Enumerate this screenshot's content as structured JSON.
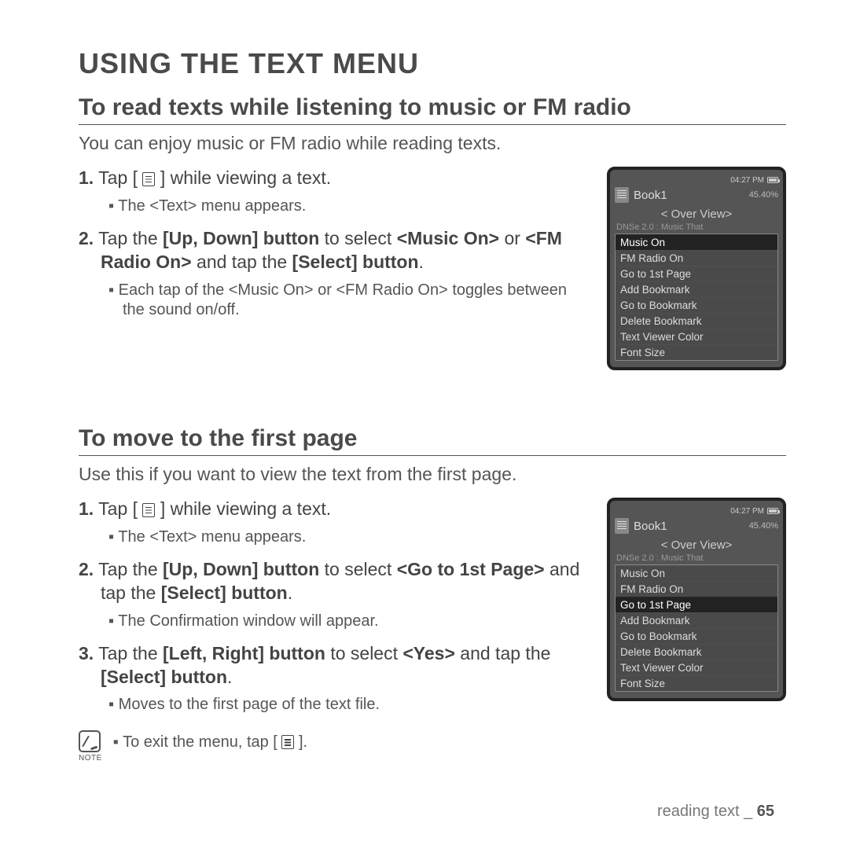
{
  "page_title": "USING THE TEXT MENU",
  "section1": {
    "heading": "To read texts while listening to music or FM radio",
    "intro": "You can enjoy music or FM radio while reading texts.",
    "step1_pre": "Tap [",
    "step1_post": "] while viewing a text.",
    "step1_bullet": "The <Text> menu appears.",
    "step2_a": "Tap the ",
    "step2_b1": "[Up, Down] button",
    "step2_c": " to select ",
    "step2_b2": "<Music On>",
    "step2_d": " or ",
    "step2_b3": "<FM Radio On>",
    "step2_e": " and tap the ",
    "step2_b4": "[Select] button",
    "step2_f": ".",
    "step2_bullet": "Each tap of the <Music On> or <FM Radio On> toggles between the sound on/off."
  },
  "section2": {
    "heading": "To move to the first page",
    "intro": "Use this if you want to view the text from the first page.",
    "step1_pre": "Tap [",
    "step1_post": "] while viewing a text.",
    "step1_bullet": "The <Text> menu appears.",
    "step2_a": "Tap the ",
    "step2_b1": "[Up, Down] button",
    "step2_c": " to select ",
    "step2_b2": "<Go to 1st Page>",
    "step2_d": " and tap the ",
    "step2_b3": "[Select] button",
    "step2_e": ".",
    "step2_bullet": "The Confirmation window will appear.",
    "step3_a": "Tap the ",
    "step3_b1": "[Left, Right] button",
    "step3_c": " to select ",
    "step3_b2": "<Yes>",
    "step3_d": " and tap the ",
    "step3_b3": "[Select] button",
    "step3_e": ".",
    "step3_bullet": "Moves to the first page of the text file."
  },
  "note": {
    "label": "NOTE",
    "text_pre": "To exit the menu, tap [",
    "text_post": "]."
  },
  "device": {
    "time": "04:27 PM",
    "book": "Book1",
    "percent": "45.40%",
    "overview": "< Over View>",
    "faded": "DNSe 2.0 : Music That",
    "items": [
      "Music On",
      "FM Radio On",
      "Go to 1st Page",
      "Add Bookmark",
      "Go to Bookmark",
      "Delete Bookmark",
      "Text Viewer Color",
      "Font Size"
    ],
    "selected1": 0,
    "selected2": 2
  },
  "footer": {
    "label": "reading text _ ",
    "page": "65"
  }
}
